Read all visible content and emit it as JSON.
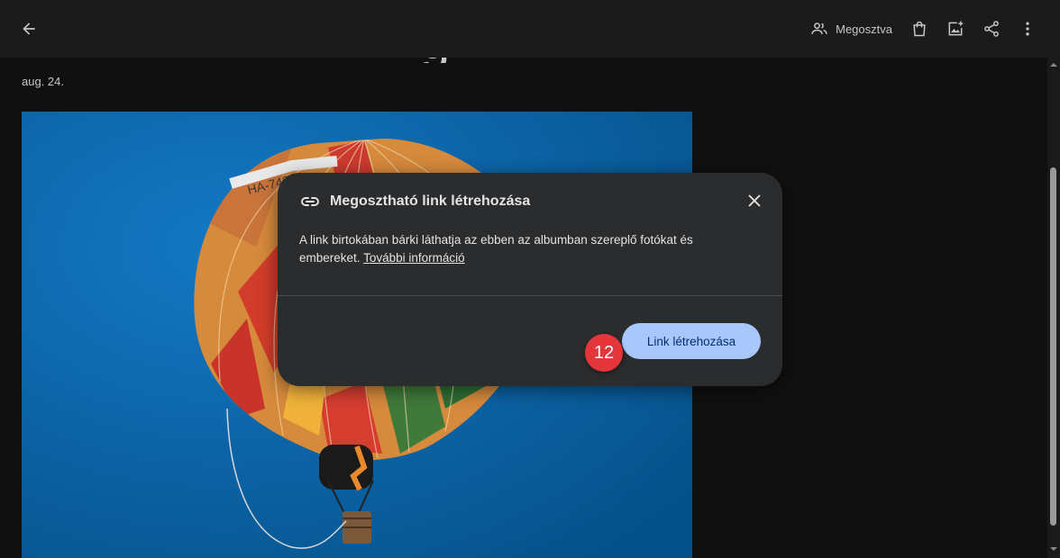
{
  "topbar": {
    "shared_label": "Megosztva"
  },
  "album": {
    "title_fragment": "g",
    "date": "aug. 24."
  },
  "dialog": {
    "title": "Megosztható link létrehozása",
    "body_text": "A link birtokában bárki láthatja az ebben az albumban szereplő fotókat és embereket.",
    "more_info_link": "További információ",
    "create_button": "Link létrehozása"
  },
  "annotation": {
    "step_number": "12"
  },
  "icons": [
    "back-arrow-icon",
    "people-icon",
    "shopping-bag-icon",
    "add-photo-icon",
    "share-icon",
    "more-vert-icon",
    "link-icon",
    "close-icon"
  ],
  "colors": {
    "topbar_bg": "#1b1b1b",
    "dialog_bg": "#2b2c2d",
    "primary_button": "#a8c7fa",
    "sky_blue": "#0a5f99",
    "step_badge": "#e4353b"
  }
}
